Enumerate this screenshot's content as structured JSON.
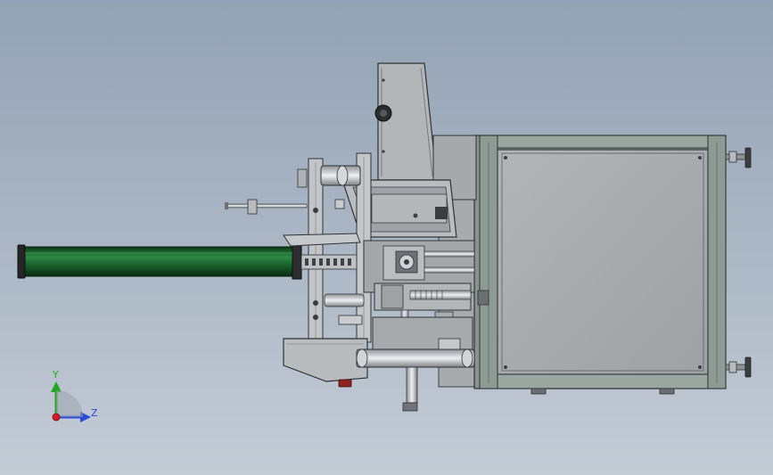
{
  "view": {
    "kind": "cad-side-view",
    "background_top": "#93a2b4",
    "background_bottom": "#c4ccd6"
  },
  "model": {
    "primary_metal": "#b9bdc1",
    "dark_metal": "#5b5f63",
    "frame_green_gray": "#87948e",
    "cylinder_color": "#0f5a25",
    "panel_fill": "#a9acae"
  },
  "triad": {
    "y_label": "Y",
    "z_label": "Z",
    "y_color": "#1fa81f",
    "z_color": "#2a4ad8",
    "origin_color": "#d31e1e"
  }
}
